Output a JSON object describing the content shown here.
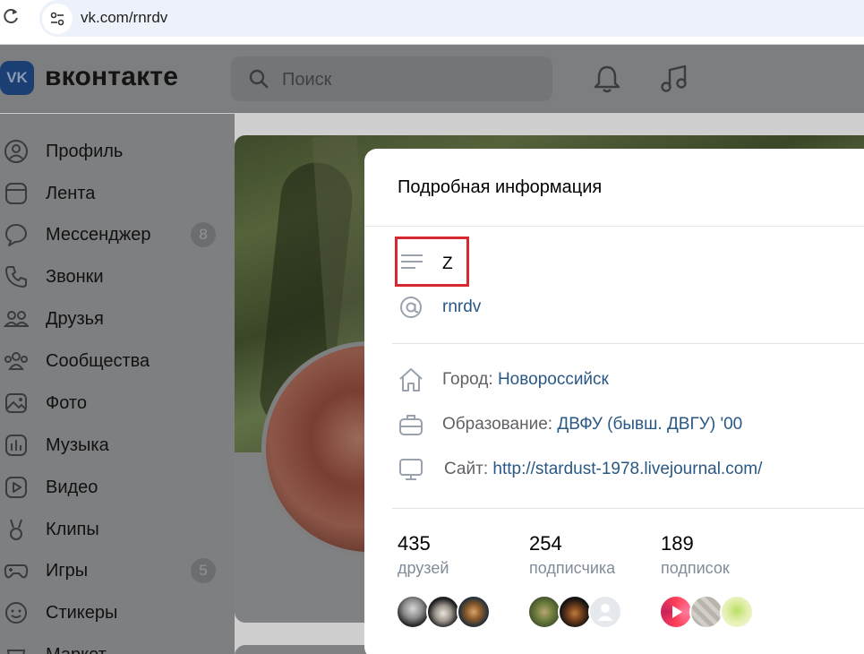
{
  "browser": {
    "url": "vk.com/rnrdv",
    "icons": [
      "reload-icon",
      "site-settings-icon"
    ]
  },
  "header": {
    "brand": "вконтакте",
    "logo_text": "VK",
    "search_placeholder": "Поиск"
  },
  "sidebar": {
    "items": [
      {
        "label": "Профиль",
        "icon": "profile-icon"
      },
      {
        "label": "Лента",
        "icon": "feed-icon"
      },
      {
        "label": "Мессенджер",
        "icon": "messenger-icon",
        "badge": "8"
      },
      {
        "label": "Звонки",
        "icon": "phone-icon"
      },
      {
        "label": "Друзья",
        "icon": "friends-icon"
      },
      {
        "label": "Сообщества",
        "icon": "communities-icon"
      },
      {
        "label": "Фото",
        "icon": "photo-icon"
      },
      {
        "label": "Музыка",
        "icon": "music-icon"
      },
      {
        "label": "Видео",
        "icon": "video-icon"
      },
      {
        "label": "Клипы",
        "icon": "clips-icon"
      },
      {
        "label": "Игры",
        "icon": "games-icon",
        "badge": "5"
      },
      {
        "label": "Стикеры",
        "icon": "stickers-icon"
      },
      {
        "label": "Маркет",
        "icon": "market-icon"
      }
    ]
  },
  "modal": {
    "title": "Подробная информация",
    "status": "Z",
    "username": "rnrdv",
    "city_label": "Город:",
    "city": "Новороссийск",
    "education_label": "Образование:",
    "education": "ДВФУ (бывш. ДВГУ) '00",
    "site_label": "Сайт:",
    "site": "http://stardust-1978.livejournal.com/",
    "stats": [
      {
        "count": "435",
        "label": "друзей"
      },
      {
        "count": "254",
        "label": "подписчика"
      },
      {
        "count": "189",
        "label": "подписок"
      }
    ]
  },
  "colors": {
    "link": "#2a5885",
    "highlight_box": "#d7272f",
    "overlay": "#7e7f81"
  }
}
